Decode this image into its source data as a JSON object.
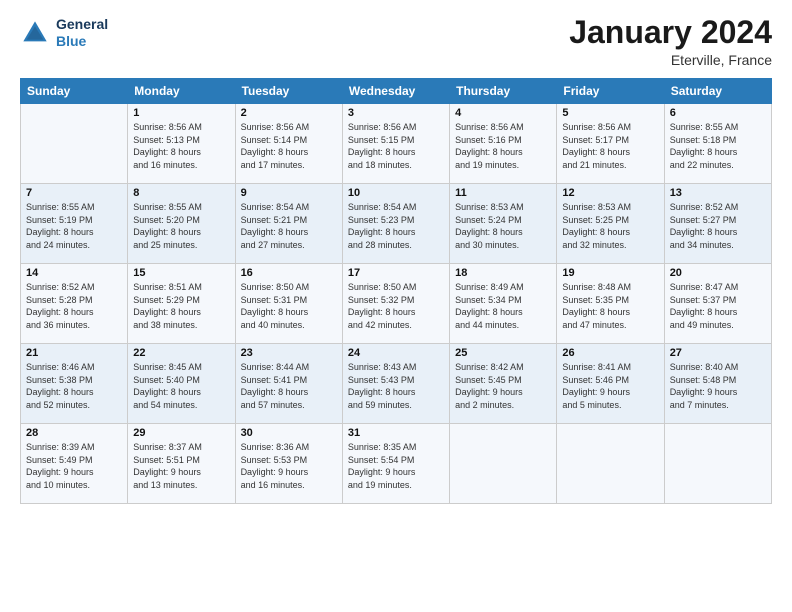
{
  "logo": {
    "line1": "General",
    "line2": "Blue"
  },
  "title": "January 2024",
  "location": "Eterville, France",
  "days_header": [
    "Sunday",
    "Monday",
    "Tuesday",
    "Wednesday",
    "Thursday",
    "Friday",
    "Saturday"
  ],
  "weeks": [
    [
      {
        "num": "",
        "info": ""
      },
      {
        "num": "1",
        "info": "Sunrise: 8:56 AM\nSunset: 5:13 PM\nDaylight: 8 hours\nand 16 minutes."
      },
      {
        "num": "2",
        "info": "Sunrise: 8:56 AM\nSunset: 5:14 PM\nDaylight: 8 hours\nand 17 minutes."
      },
      {
        "num": "3",
        "info": "Sunrise: 8:56 AM\nSunset: 5:15 PM\nDaylight: 8 hours\nand 18 minutes."
      },
      {
        "num": "4",
        "info": "Sunrise: 8:56 AM\nSunset: 5:16 PM\nDaylight: 8 hours\nand 19 minutes."
      },
      {
        "num": "5",
        "info": "Sunrise: 8:56 AM\nSunset: 5:17 PM\nDaylight: 8 hours\nand 21 minutes."
      },
      {
        "num": "6",
        "info": "Sunrise: 8:55 AM\nSunset: 5:18 PM\nDaylight: 8 hours\nand 22 minutes."
      }
    ],
    [
      {
        "num": "7",
        "info": "Sunrise: 8:55 AM\nSunset: 5:19 PM\nDaylight: 8 hours\nand 24 minutes."
      },
      {
        "num": "8",
        "info": "Sunrise: 8:55 AM\nSunset: 5:20 PM\nDaylight: 8 hours\nand 25 minutes."
      },
      {
        "num": "9",
        "info": "Sunrise: 8:54 AM\nSunset: 5:21 PM\nDaylight: 8 hours\nand 27 minutes."
      },
      {
        "num": "10",
        "info": "Sunrise: 8:54 AM\nSunset: 5:23 PM\nDaylight: 8 hours\nand 28 minutes."
      },
      {
        "num": "11",
        "info": "Sunrise: 8:53 AM\nSunset: 5:24 PM\nDaylight: 8 hours\nand 30 minutes."
      },
      {
        "num": "12",
        "info": "Sunrise: 8:53 AM\nSunset: 5:25 PM\nDaylight: 8 hours\nand 32 minutes."
      },
      {
        "num": "13",
        "info": "Sunrise: 8:52 AM\nSunset: 5:27 PM\nDaylight: 8 hours\nand 34 minutes."
      }
    ],
    [
      {
        "num": "14",
        "info": "Sunrise: 8:52 AM\nSunset: 5:28 PM\nDaylight: 8 hours\nand 36 minutes."
      },
      {
        "num": "15",
        "info": "Sunrise: 8:51 AM\nSunset: 5:29 PM\nDaylight: 8 hours\nand 38 minutes."
      },
      {
        "num": "16",
        "info": "Sunrise: 8:50 AM\nSunset: 5:31 PM\nDaylight: 8 hours\nand 40 minutes."
      },
      {
        "num": "17",
        "info": "Sunrise: 8:50 AM\nSunset: 5:32 PM\nDaylight: 8 hours\nand 42 minutes."
      },
      {
        "num": "18",
        "info": "Sunrise: 8:49 AM\nSunset: 5:34 PM\nDaylight: 8 hours\nand 44 minutes."
      },
      {
        "num": "19",
        "info": "Sunrise: 8:48 AM\nSunset: 5:35 PM\nDaylight: 8 hours\nand 47 minutes."
      },
      {
        "num": "20",
        "info": "Sunrise: 8:47 AM\nSunset: 5:37 PM\nDaylight: 8 hours\nand 49 minutes."
      }
    ],
    [
      {
        "num": "21",
        "info": "Sunrise: 8:46 AM\nSunset: 5:38 PM\nDaylight: 8 hours\nand 52 minutes."
      },
      {
        "num": "22",
        "info": "Sunrise: 8:45 AM\nSunset: 5:40 PM\nDaylight: 8 hours\nand 54 minutes."
      },
      {
        "num": "23",
        "info": "Sunrise: 8:44 AM\nSunset: 5:41 PM\nDaylight: 8 hours\nand 57 minutes."
      },
      {
        "num": "24",
        "info": "Sunrise: 8:43 AM\nSunset: 5:43 PM\nDaylight: 8 hours\nand 59 minutes."
      },
      {
        "num": "25",
        "info": "Sunrise: 8:42 AM\nSunset: 5:45 PM\nDaylight: 9 hours\nand 2 minutes."
      },
      {
        "num": "26",
        "info": "Sunrise: 8:41 AM\nSunset: 5:46 PM\nDaylight: 9 hours\nand 5 minutes."
      },
      {
        "num": "27",
        "info": "Sunrise: 8:40 AM\nSunset: 5:48 PM\nDaylight: 9 hours\nand 7 minutes."
      }
    ],
    [
      {
        "num": "28",
        "info": "Sunrise: 8:39 AM\nSunset: 5:49 PM\nDaylight: 9 hours\nand 10 minutes."
      },
      {
        "num": "29",
        "info": "Sunrise: 8:37 AM\nSunset: 5:51 PM\nDaylight: 9 hours\nand 13 minutes."
      },
      {
        "num": "30",
        "info": "Sunrise: 8:36 AM\nSunset: 5:53 PM\nDaylight: 9 hours\nand 16 minutes."
      },
      {
        "num": "31",
        "info": "Sunrise: 8:35 AM\nSunset: 5:54 PM\nDaylight: 9 hours\nand 19 minutes."
      },
      {
        "num": "",
        "info": ""
      },
      {
        "num": "",
        "info": ""
      },
      {
        "num": "",
        "info": ""
      }
    ]
  ]
}
